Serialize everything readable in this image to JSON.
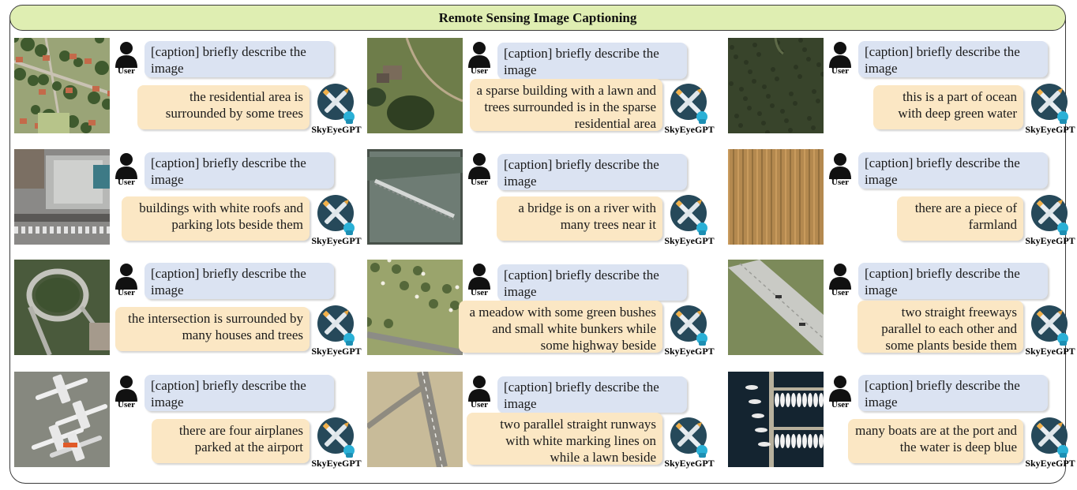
{
  "title": "Remote Sensing Image Captioning",
  "user_label": "User",
  "bot_label": "SkyEyeGPT",
  "prompt": "[caption] briefly describe the image",
  "cells": [
    {
      "id": "residential",
      "answer": "the residential area is surrounded by some trees",
      "scene": "residential"
    },
    {
      "id": "sparse-building",
      "answer": "a sparse building with a lawn and trees surrounded is in the sparse residential area",
      "scene": "sparse"
    },
    {
      "id": "ocean",
      "answer": "this is a part of ocean with deep green water",
      "scene": "ocean"
    },
    {
      "id": "white-roofs",
      "answer": "buildings with white roofs and parking lots beside them",
      "scene": "roofs"
    },
    {
      "id": "bridge",
      "answer": "a bridge is on a river with many trees near it",
      "scene": "bridge"
    },
    {
      "id": "farmland",
      "answer": "there are a piece of farmland",
      "scene": "farmland"
    },
    {
      "id": "intersection",
      "answer": "the intersection is surrounded by many houses and trees",
      "scene": "intersection"
    },
    {
      "id": "meadow",
      "answer": "a meadow with some green bushes and small white bunkers while some highway beside",
      "scene": "meadow"
    },
    {
      "id": "freeways",
      "answer": "two straight freeways parallel to each other and some plants beside them",
      "scene": "freeway"
    },
    {
      "id": "airplanes",
      "answer": "there are four airplanes parked at the airport",
      "scene": "airport"
    },
    {
      "id": "runways",
      "answer": "two parallel straight runways with white marking lines on while a lawn beside",
      "scene": "runway"
    },
    {
      "id": "boats",
      "answer": "many boats are at the port and the water is deep blue",
      "scene": "port"
    }
  ],
  "colors": {
    "title_bg": "#dfeeb2",
    "question_bg": "#dbe3f2",
    "answer_bg": "#fbe7c4",
    "bot_circle": "#26495a"
  }
}
